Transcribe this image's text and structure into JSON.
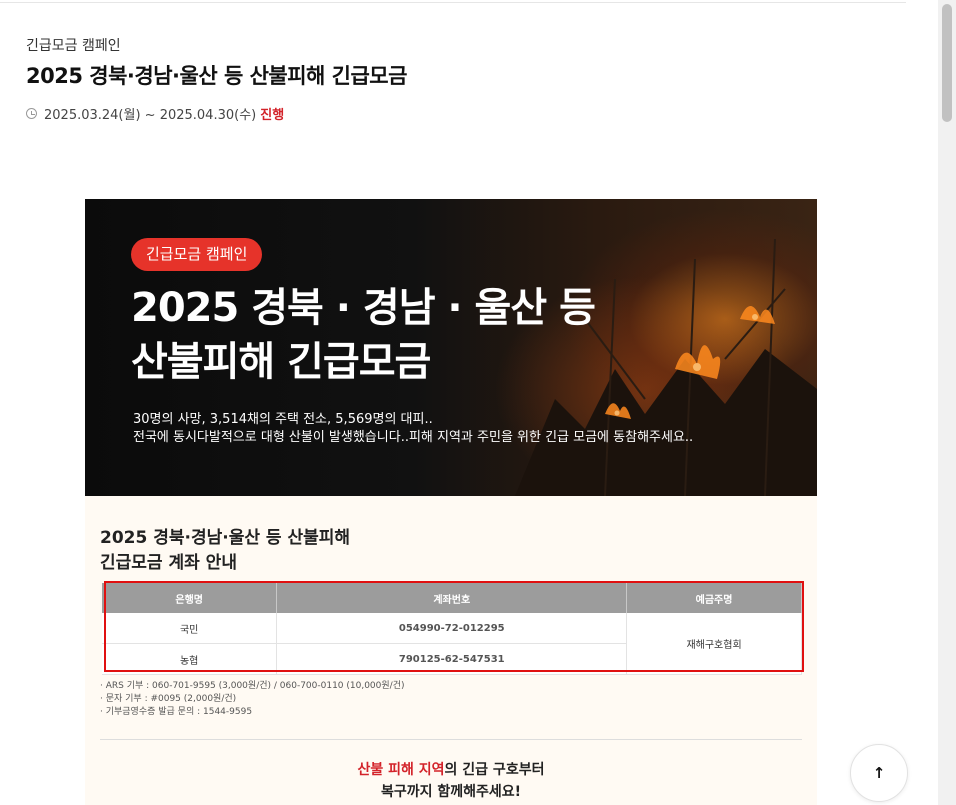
{
  "header": {
    "category": "긴급모금 캠페인",
    "title": "2025 경북·경남·울산 등 산불피해 긴급모금",
    "period": "2025.03.24(월) ~ 2025.04.30(수)",
    "status": "진행"
  },
  "banner": {
    "badge": "긴급모금 캠페인",
    "title_line1": "2025 경북 · 경남 · 울산 등",
    "title_line2": "산불피해 긴급모금",
    "desc_line1": "30명의 사망, 3,514채의 주택 전소, 5,569명의 대피..",
    "desc_line2": "전국에 동시다발적으로 대형 산불이 발생했습니다..피해 지역과 주민을 위한 긴급 모금에 동참해주세요.."
  },
  "account_info": {
    "title_line1": "2025 경북·경남·울산 등 산불피해",
    "title_line2": "긴급모금 계좌 안내",
    "headers": [
      "은행명",
      "계좌번호",
      "예금주명"
    ],
    "rows": [
      {
        "bank": "국민",
        "account": "054990-72-012295"
      },
      {
        "bank": "농협",
        "account": "790125-62-547531"
      }
    ],
    "holder": "재해구호협회",
    "notes": [
      "· ARS 기부 : 060-701-9595 (3,000원/건) / 060-700-0110 (10,000원/건)",
      "· 문자 기부 : #0095 (2,000원/건)",
      "· 기부금영수증 발급 문의 : 1544-9595"
    ],
    "closing_highlight": "산불 피해 지역",
    "closing_rest": "의 긴급 구호부터",
    "closing_line2": "복구까지 함께해주세요!"
  },
  "colors": {
    "accent": "#d3232a",
    "badge": "#e6332a",
    "table_header": "#9c9c9c"
  },
  "controls": {
    "scroll_top_icon": "arrow-up-icon"
  }
}
